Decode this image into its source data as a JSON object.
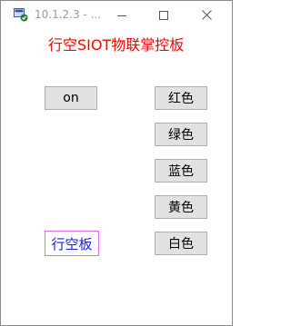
{
  "window": {
    "title": "10.1.2.3 - ...",
    "controls": {
      "minimize": "minimize-icon",
      "maximize": "maximize-icon",
      "close": "close-icon"
    }
  },
  "main": {
    "heading": "行空SIOT物联掌控板",
    "heading_color": "#ff0000",
    "on_button": "on",
    "color_buttons": {
      "red": "红色",
      "green": "绿色",
      "blue": "蓝色",
      "yellow": "黄色",
      "white": "白色"
    },
    "board_label": "行空板",
    "board_label_color": "#1a1aff",
    "board_label_border": "#e070e8"
  }
}
